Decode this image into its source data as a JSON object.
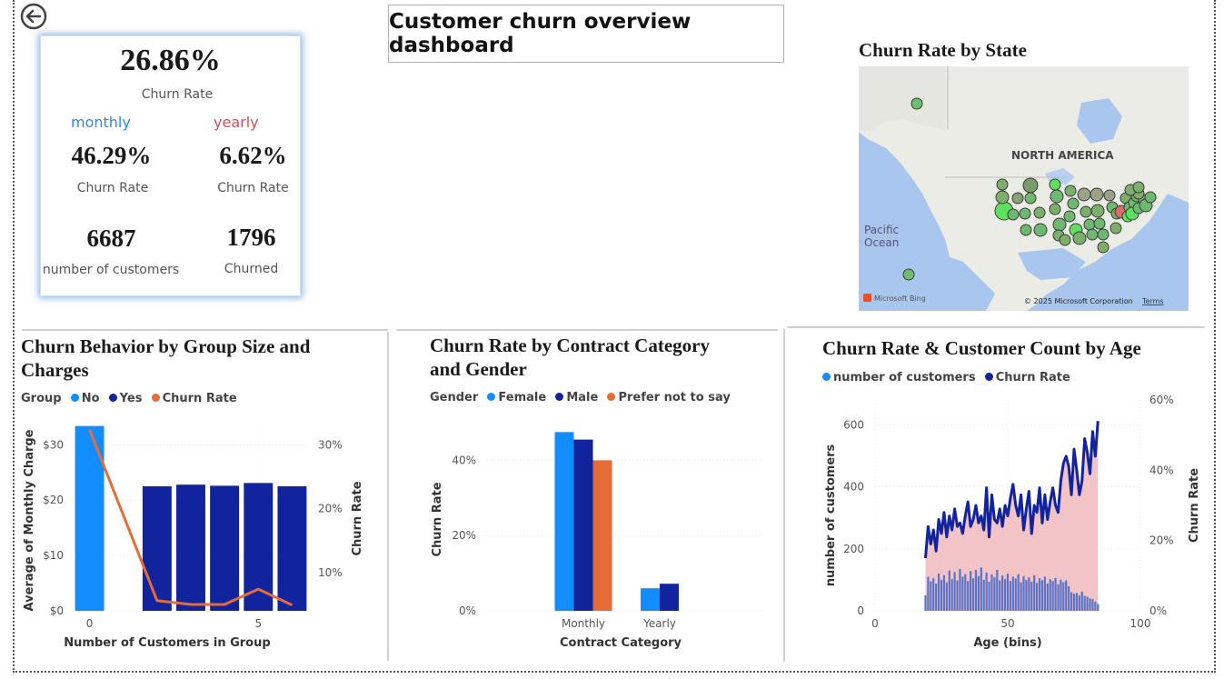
{
  "page": {
    "title": "Customer churn overview dashboard"
  },
  "kpi": {
    "churn_rate": "26.86%",
    "churn_rate_label": "Churn Rate",
    "monthly_label": "monthly",
    "yearly_label": "yearly",
    "monthly_rate": "46.29%",
    "monthly_rate_label": "Churn Rate",
    "yearly_rate": "6.62%",
    "yearly_rate_label": "Churn Rate",
    "customers": "6687",
    "customers_label": "number of customers",
    "churned": "1796",
    "churned_label": "Churned",
    "monthly_color": "#2b8ae6",
    "yearly_color": "#d1505a"
  },
  "map": {
    "title": "Churn Rate by State",
    "continent_label": "NORTH AMERICA",
    "ocean_label_1": "Pacific",
    "ocean_label_2": "Ocean",
    "bing_label": "Microsoft Bing",
    "copyright": "© 2025 Microsoft Corporation",
    "terms": "Terms"
  },
  "chart_data": [
    {
      "type": "bar",
      "title": "Churn Behavior by Group Size and Charges",
      "legend_title": "Group",
      "legend": [
        {
          "name": "No",
          "color": "#118dff"
        },
        {
          "name": "Yes",
          "color": "#12239e"
        },
        {
          "name": "Churn Rate",
          "color": "#e66c37"
        }
      ],
      "xlabel": "Number of Customers in Group",
      "ylabel": "Average of Monthly Charge",
      "y2label": "Churn Rate",
      "x_ticks": [
        "0",
        "5"
      ],
      "y_ticks": [
        "$0",
        "$10",
        "$20",
        "$30"
      ],
      "y2_ticks": [
        "10%",
        "20%",
        "30%"
      ],
      "ylim": [
        0,
        34
      ],
      "y2lim": [
        4,
        33.5
      ],
      "bars": [
        {
          "x": 0,
          "group": "No",
          "value": 33.4
        },
        {
          "x": 2,
          "group": "Yes",
          "value": 22.5
        },
        {
          "x": 3,
          "group": "Yes",
          "value": 22.8
        },
        {
          "x": 4,
          "group": "Yes",
          "value": 22.6
        },
        {
          "x": 5,
          "group": "Yes",
          "value": 23.1
        },
        {
          "x": 6,
          "group": "Yes",
          "value": 22.5
        }
      ],
      "line": {
        "name": "Churn Rate",
        "x": [
          0,
          2,
          3,
          4,
          5,
          6
        ],
        "values": [
          32.4,
          5.6,
          5.0,
          5.0,
          7.4,
          4.9
        ]
      }
    },
    {
      "type": "bar",
      "title": "Churn Rate by Contract Category and Gender",
      "legend_title": "Gender",
      "legend": [
        {
          "name": "Female",
          "color": "#118dff"
        },
        {
          "name": "Male",
          "color": "#12239e"
        },
        {
          "name": "Prefer not to say",
          "color": "#e66c37"
        }
      ],
      "categories": [
        "Monthly",
        "Yearly"
      ],
      "xlabel": "Contract Category",
      "ylabel": "Churn Rate",
      "y_ticks": [
        "0%",
        "20%",
        "40%"
      ],
      "ylim": [
        0,
        50
      ],
      "series": [
        {
          "name": "Female",
          "values": [
            47.5,
            6.0
          ]
        },
        {
          "name": "Male",
          "values": [
            45.5,
            7.2
          ]
        },
        {
          "name": "Prefer not to say",
          "values": [
            40.0,
            null
          ]
        }
      ]
    },
    {
      "type": "bar",
      "title": "Churn Rate & Customer Count by Age",
      "legend": [
        {
          "name": "number of customers",
          "color": "#118dff"
        },
        {
          "name": "Churn Rate",
          "color": "#12239e"
        }
      ],
      "xlabel": "Age (bins)",
      "ylabel": "number of customers",
      "y2label": "Churn Rate",
      "x_ticks": [
        "0",
        "50",
        "100"
      ],
      "y_ticks": [
        "0",
        "200",
        "400",
        "600"
      ],
      "y2_ticks": [
        "0%",
        "20%",
        "40%",
        "60%"
      ],
      "xlim": [
        0,
        100
      ],
      "ylim": [
        0,
        680
      ],
      "y2lim": [
        0,
        60
      ],
      "ages": [
        19,
        20,
        21,
        22,
        23,
        24,
        25,
        26,
        27,
        28,
        29,
        30,
        31,
        32,
        33,
        34,
        35,
        36,
        37,
        38,
        39,
        40,
        41,
        42,
        43,
        44,
        45,
        46,
        47,
        48,
        49,
        50,
        51,
        52,
        53,
        54,
        55,
        56,
        57,
        58,
        59,
        60,
        61,
        62,
        63,
        64,
        65,
        66,
        67,
        68,
        69,
        70,
        71,
        72,
        73,
        74,
        75,
        76,
        77,
        78,
        79,
        80,
        81,
        82,
        83,
        84
      ],
      "customers": [
        50,
        110,
        95,
        105,
        88,
        120,
        100,
        115,
        92,
        130,
        102,
        125,
        98,
        135,
        110,
        118,
        96,
        128,
        105,
        132,
        112,
        140,
        100,
        123,
        94,
        117,
        108,
        132,
        98,
        114,
        102,
        120,
        96,
        110,
        104,
        118,
        92,
        112,
        100,
        108,
        94,
        115,
        90,
        105,
        99,
        110,
        88,
        102,
        96,
        106,
        86,
        100,
        92,
        98,
        80,
        60,
        55,
        58,
        50,
        62,
        48,
        45,
        40,
        38,
        30,
        22
      ],
      "churn_rate": [
        15,
        24,
        19,
        23,
        17,
        26,
        22,
        28,
        21,
        27,
        23,
        29,
        24,
        25,
        22,
        27,
        31,
        24,
        26,
        30,
        25,
        27,
        23,
        35,
        21,
        33,
        26,
        25,
        29,
        24,
        30,
        27,
        32,
        36,
        30,
        27,
        33,
        23,
        29,
        34,
        22,
        30,
        28,
        35,
        25,
        33,
        26,
        31,
        35,
        30,
        28,
        37,
        42,
        44,
        41,
        33,
        46,
        40,
        33,
        37,
        49,
        45,
        39,
        51,
        44,
        54
      ]
    }
  ]
}
